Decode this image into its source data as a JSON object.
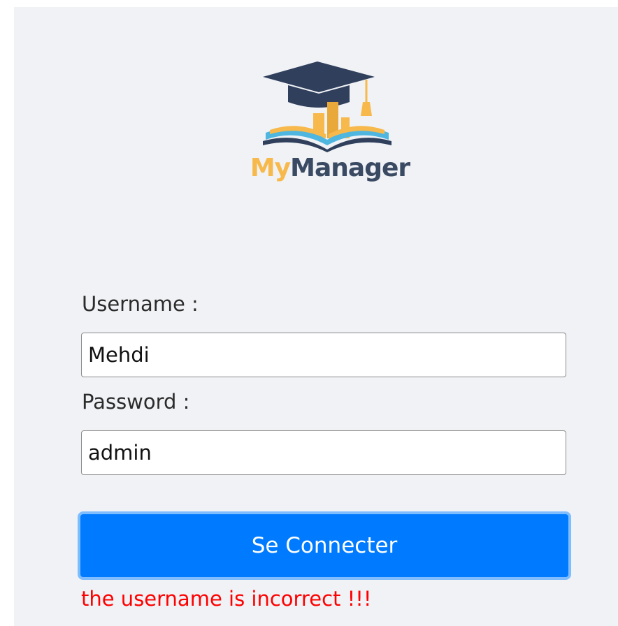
{
  "brand": {
    "name_part1": "My",
    "name_part2": "Manager",
    "icon": "graduation-cap-book-logo",
    "colors": {
      "accent": "#f7b94c",
      "dark": "#3b4a63",
      "blue": "#4fb6e0"
    }
  },
  "form": {
    "username_label": "Username :",
    "username_value": "Mehdi",
    "password_label": "Password :",
    "password_value": "admin",
    "submit_label": "Se Connecter",
    "error_message": "the username is incorrect !!!"
  },
  "colors": {
    "button": "#007bff",
    "error": "#ff0000",
    "background": "#f0f2f5"
  }
}
